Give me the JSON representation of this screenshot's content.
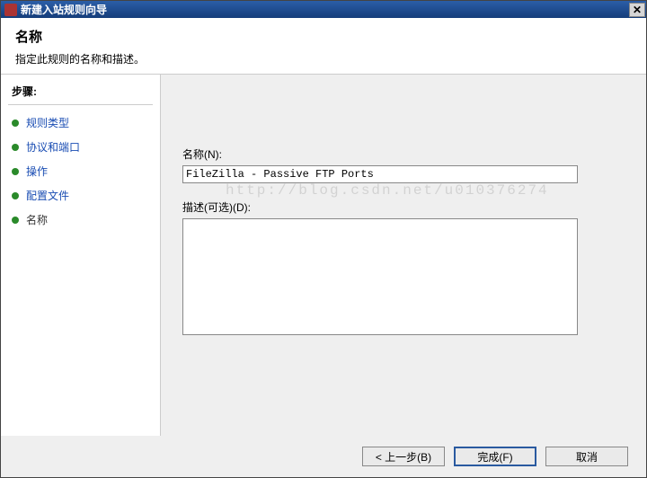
{
  "window": {
    "title": "新建入站规则向导",
    "close_label": "✕"
  },
  "header": {
    "title": "名称",
    "subtitle": "指定此规则的名称和描述。"
  },
  "sidebar": {
    "title": "步骤:",
    "items": [
      {
        "label": "规则类型",
        "state": "done"
      },
      {
        "label": "协议和端口",
        "state": "done"
      },
      {
        "label": "操作",
        "state": "done"
      },
      {
        "label": "配置文件",
        "state": "done"
      },
      {
        "label": "名称",
        "state": "current"
      }
    ]
  },
  "form": {
    "name_label": "名称(N):",
    "name_value": "FileZilla - Passive FTP Ports",
    "desc_label": "描述(可选)(D):",
    "desc_value": ""
  },
  "footer": {
    "back": "< 上一步(B)",
    "finish": "完成(F)",
    "cancel": "取消"
  },
  "watermark": "http://blog.csdn.net/u010376274"
}
